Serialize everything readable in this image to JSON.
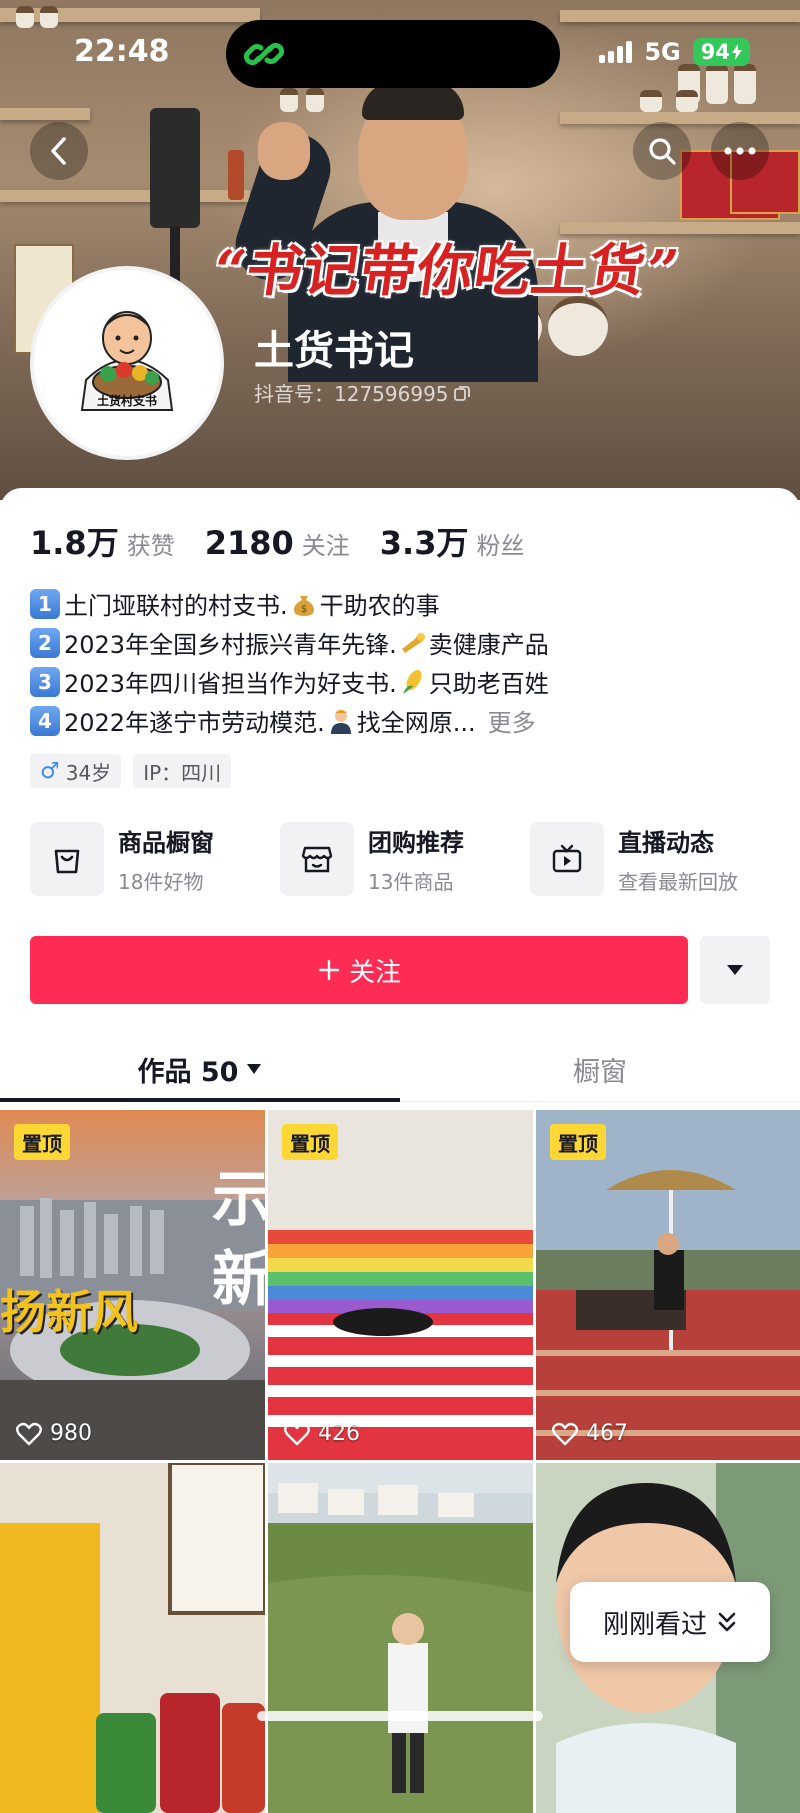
{
  "status_bar": {
    "time": "22:48",
    "network": "5G",
    "battery": "94"
  },
  "cover": {
    "slogan": "“书记带你吃土货”"
  },
  "profile": {
    "nickname": "土货书记",
    "douyin_id": "抖音号：127596995",
    "avatar_caption": "土货村支书"
  },
  "stats": [
    {
      "num": "1.8万",
      "label": "获赞"
    },
    {
      "num": "2180",
      "label": "关注"
    },
    {
      "num": "3.3万",
      "label": "粉丝"
    }
  ],
  "bio": [
    {
      "badge": "1",
      "text_a": "土门垭联村的村支书.",
      "emoji": "money-bag-icon",
      "text_b": "干助农的事"
    },
    {
      "badge": "2",
      "text_a": "2023年全国乡村振兴青年先锋.",
      "emoji": "trumpet-icon",
      "text_b": "卖健康产品"
    },
    {
      "badge": "3",
      "text_a": "2023年四川省担当作为好支书.",
      "emoji": "corn-icon",
      "text_b": "只助老百姓"
    },
    {
      "badge": "4",
      "text_a": "2022年遂宁市劳动模范.",
      "emoji": "person-icon",
      "text_b": "找全网原..."
    }
  ],
  "bio_more": "更多",
  "tags": {
    "age": "34岁",
    "ip": "IP：四川"
  },
  "services": [
    {
      "title": "商品橱窗",
      "sub": "18件好物",
      "icon": "bag-icon"
    },
    {
      "title": "团购推荐",
      "sub": "13件商品",
      "icon": "shop-icon"
    },
    {
      "title": "直播动态",
      "sub": "查看最新回放",
      "icon": "tv-icon"
    }
  ],
  "follow_label": "关注",
  "tabs": {
    "works": "作品 50",
    "showcase": "橱窗"
  },
  "videos": [
    {
      "pinned": "置顶",
      "likes": "980",
      "overlay": "扬新风"
    },
    {
      "pinned": "置顶",
      "likes": "426"
    },
    {
      "pinned": "置顶",
      "likes": "467"
    }
  ],
  "recent_label": "刚刚看过",
  "colors": {
    "accent": "#fe2c55",
    "pin": "#fdd835",
    "battery": "#34c759"
  }
}
